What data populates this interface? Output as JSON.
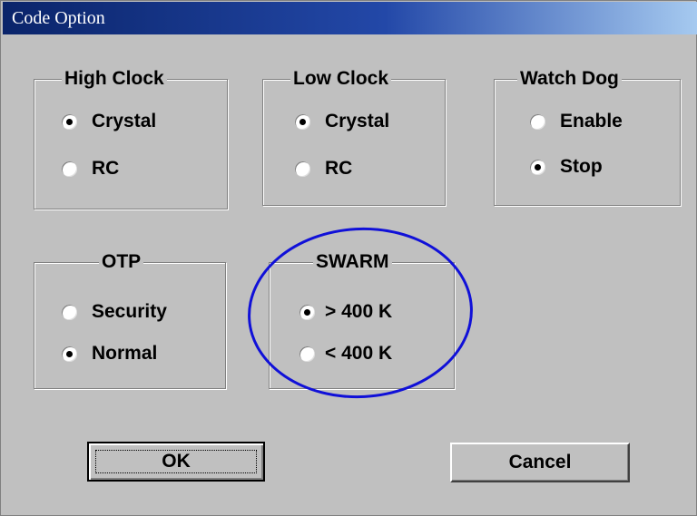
{
  "window": {
    "title": "Code Option"
  },
  "groups": {
    "high_clock": {
      "label": "High Clock",
      "options": [
        "Crystal",
        "RC"
      ],
      "selected": "Crystal"
    },
    "low_clock": {
      "label": "Low Clock",
      "options": [
        "Crystal",
        "RC"
      ],
      "selected": "Crystal"
    },
    "watch_dog": {
      "label": "Watch Dog",
      "options": [
        "Enable",
        "Stop"
      ],
      "selected": "Stop"
    },
    "otp": {
      "label": "OTP",
      "options": [
        "Security",
        "Normal"
      ],
      "selected": "Normal"
    },
    "swarm": {
      "label": "SWARM",
      "options": [
        "> 400 K",
        "< 400 K"
      ],
      "selected": "> 400 K"
    }
  },
  "buttons": {
    "ok": "OK",
    "cancel": "Cancel"
  },
  "annotation": {
    "color": "#1010d8",
    "shape": "ellipse"
  }
}
